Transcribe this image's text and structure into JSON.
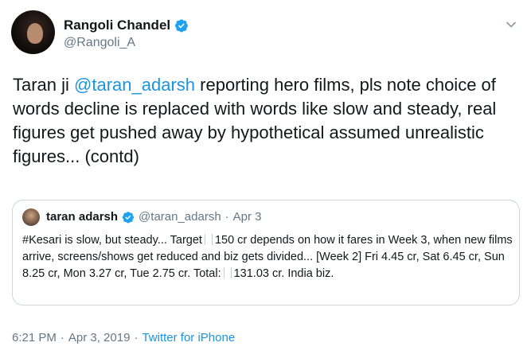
{
  "author": {
    "display_name": "Rangoli Chandel",
    "handle": "@Rangoli_A"
  },
  "tweet": {
    "text_prefix": "Taran ji ",
    "mention": "@taran_adarsh",
    "text_suffix": " reporting hero films, pls note choice of words decline is replaced with words like slow and steady, real figures get pushed away by hypothetical assumed unrealistic figures...  (contd)"
  },
  "quoted_tweet": {
    "display_name": "taran adarsh",
    "handle": "@taran_adarsh",
    "separator": "·",
    "date": "Apr 3",
    "text_part1": "#Kesari is slow, but steady... Target",
    "text_part2": "150 cr depends on how it fares in Week 3, when new films arrive, screens/shows get reduced and biz gets divided... [Week 2] Fri 4.45 cr, Sat 6.45 cr, Sun 8.25 cr, Mon 3.27 cr, Tue 2.75 cr. Total:",
    "text_part3": "131.03 cr. India biz."
  },
  "footer": {
    "time": "6:21 PM",
    "dot1": "·",
    "date": "Apr 3, 2019",
    "dot2": "·",
    "source": "Twitter for iPhone"
  },
  "icons": {
    "verified": "verified-badge-icon",
    "chevron": "chevron-down-icon"
  },
  "colors": {
    "link": "#1b95e0",
    "verified": "#1da1f2",
    "muted": "#657786",
    "border": "#ccd6dd"
  }
}
